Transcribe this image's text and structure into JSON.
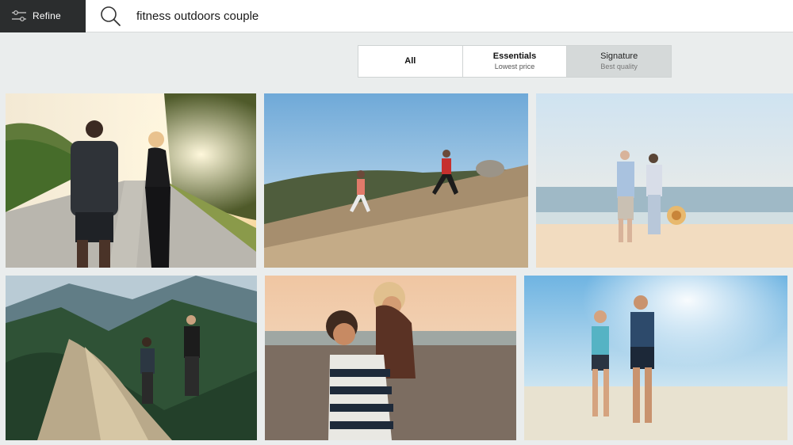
{
  "toolbar": {
    "refine_label": "Refine",
    "refine_icon": "sliders-icon",
    "search_icon": "search-icon"
  },
  "search": {
    "query": "fitness outdoors couple"
  },
  "tabs": [
    {
      "label": "All",
      "sublabel": ""
    },
    {
      "label": "Essentials",
      "sublabel": "Lowest price"
    },
    {
      "label": "Signature",
      "sublabel": "Best quality"
    }
  ],
  "colors": {
    "toolbar_dark": "#2b2d2e",
    "page_bg": "#eaeded",
    "selected_tab": "#d5d9d9"
  }
}
